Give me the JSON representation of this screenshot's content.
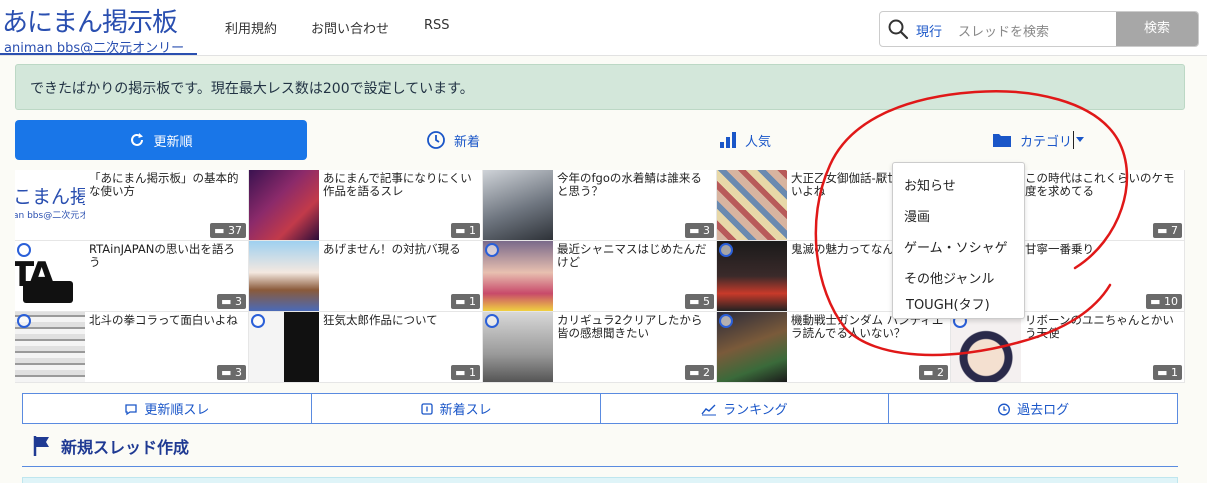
{
  "header": {
    "logo_title": "あにまん掲示板",
    "logo_subtitle": "animan bbs@二次元オンリー",
    "nav": [
      "利用規約",
      "お問い合わせ",
      "RSS"
    ],
    "search": {
      "scope": "現行",
      "placeholder": "スレッドを検索",
      "button": "検索"
    }
  },
  "notice": "できたばかりの掲示板です。現在最大レス数は200で設定しています。",
  "tabs": [
    {
      "label": "更新順",
      "icon": "refresh-icon",
      "active": true
    },
    {
      "label": "新着",
      "icon": "clock-icon",
      "active": false
    },
    {
      "label": "人気",
      "icon": "bar-chart-icon",
      "active": false
    },
    {
      "label": "カテゴリ",
      "icon": "folder-icon",
      "active": false
    }
  ],
  "threads": [
    {
      "title": "「あにまん掲示板」の基本的な使い方",
      "count": "37",
      "thumb": "logo"
    },
    {
      "title": "あにまんで記事になりにくい作品を語るスレ",
      "count": "1",
      "thumb": "purple"
    },
    {
      "title": "今年のfgoの水着鯖は誰来ると思う？",
      "count": "3",
      "thumb": "grey"
    },
    {
      "title": "大正乙女御伽話-厭世家-卓-良いよね",
      "count": "",
      "thumb": "colorful"
    },
    {
      "title": "この時代はこれくらいのケモ度を求めてる",
      "count": "7",
      "thumb": "none"
    },
    {
      "title": "RTAinJAPANの思い出を語ろう",
      "count": "3",
      "thumb": "rta"
    },
    {
      "title": "あげません！の対抗バ現る",
      "count": "1",
      "thumb": "horse"
    },
    {
      "title": "最近シャニマスはじめたんだけど",
      "count": "5",
      "thumb": "idol"
    },
    {
      "title": "鬼滅の魅力ってなんや？",
      "count": "",
      "thumb": "dark"
    },
    {
      "title": "甘寧一番乗り",
      "count": "10",
      "thumb": "none"
    },
    {
      "title": "北斗の拳コラって面白いよね",
      "count": "3",
      "thumb": "manga"
    },
    {
      "title": "狂気太郎作品について",
      "count": "1",
      "thumb": "bw"
    },
    {
      "title": "カリギュラ2クリアしたから皆の感想聞きたい",
      "count": "2",
      "thumb": "silver"
    },
    {
      "title": "機動戦士ガンダム ハンディエラ読んでる人いない？",
      "count": "2",
      "thumb": "gundam"
    },
    {
      "title": "リボーンのユニちゃんとかいう天使",
      "count": "1",
      "thumb": "uni"
    }
  ],
  "category_menu": [
    "お知らせ",
    "漫画",
    "ゲーム・ソシャゲ",
    "その他ジャンル",
    "TOUGH(タフ)"
  ],
  "bottom_nav": [
    {
      "label": "更新順スレ",
      "icon": "chat-icon"
    },
    {
      "label": "新着スレ",
      "icon": "new-icon"
    },
    {
      "label": "ランキング",
      "icon": "trend-icon"
    },
    {
      "label": "過去ログ",
      "icon": "history-icon"
    }
  ],
  "section_title": "新規スレッド作成",
  "colors": {
    "brand": "#2a4fb0",
    "accent": "#1976e8",
    "notice_bg": "#d3e7da",
    "annotation": "#e01818"
  }
}
